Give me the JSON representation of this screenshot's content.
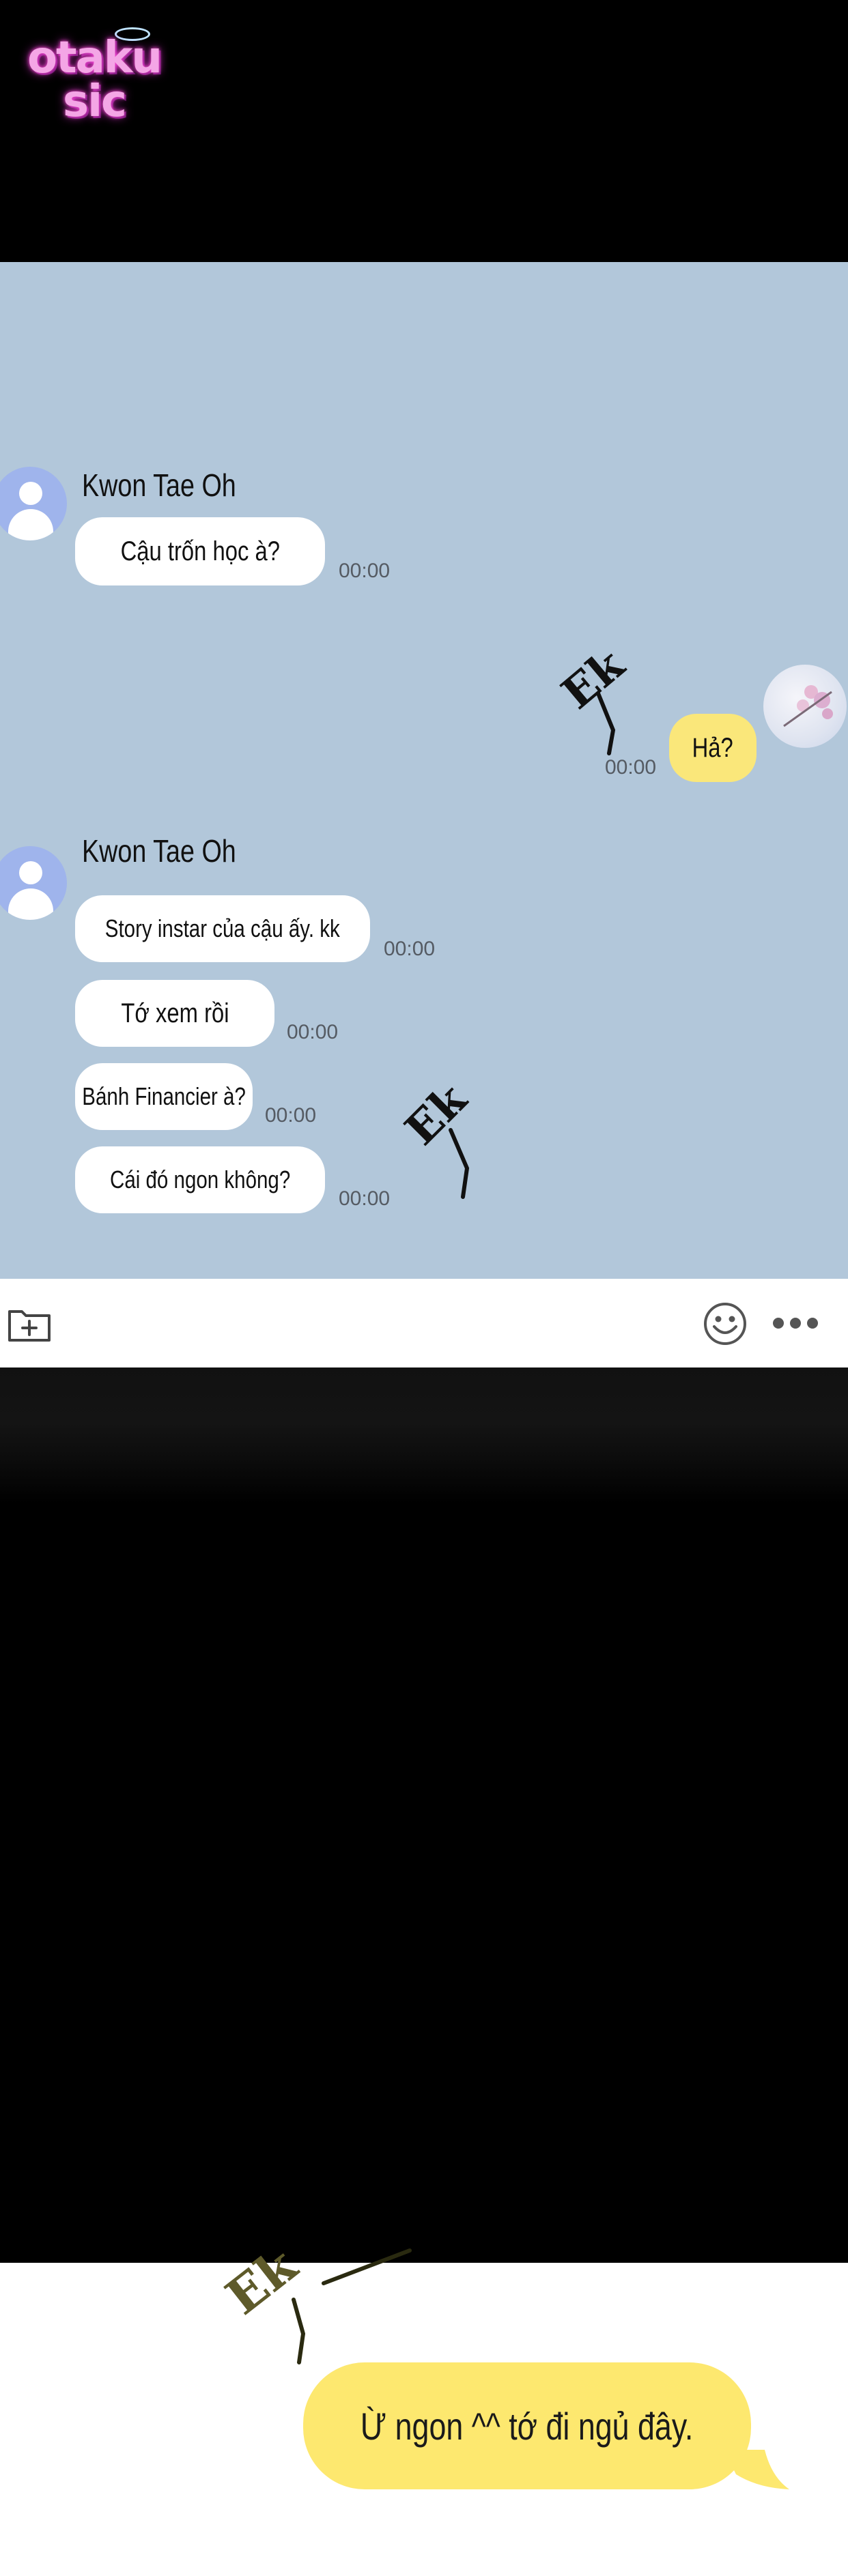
{
  "logo": {
    "line1": "otaku",
    "line2": "sic"
  },
  "chat": {
    "messages": [
      {
        "sender": "Kwon Tae Oh",
        "text": "Cậu trốn học à?",
        "time": "00:00"
      },
      {
        "text": "Hả?",
        "time": "00:00",
        "mine": true
      },
      {
        "sender": "Kwon Tae Oh",
        "text": "Story instar của cậu ấy. kk",
        "time": "00:00"
      },
      {
        "text": "Tớ xem rồi",
        "time": "00:00"
      },
      {
        "text": "Bánh Financier à?",
        "time": "00:00"
      },
      {
        "text": "Cái đó ngon không?",
        "time": "00:00"
      }
    ],
    "sfx": [
      "Ek",
      "Ek",
      "Ek"
    ]
  },
  "input_bar": {
    "icons": [
      "add-file-icon",
      "emoji-icon",
      "more-options-icon"
    ]
  },
  "reply": {
    "text": "Ừ ngon ^^ tớ đi ngủ đây."
  }
}
